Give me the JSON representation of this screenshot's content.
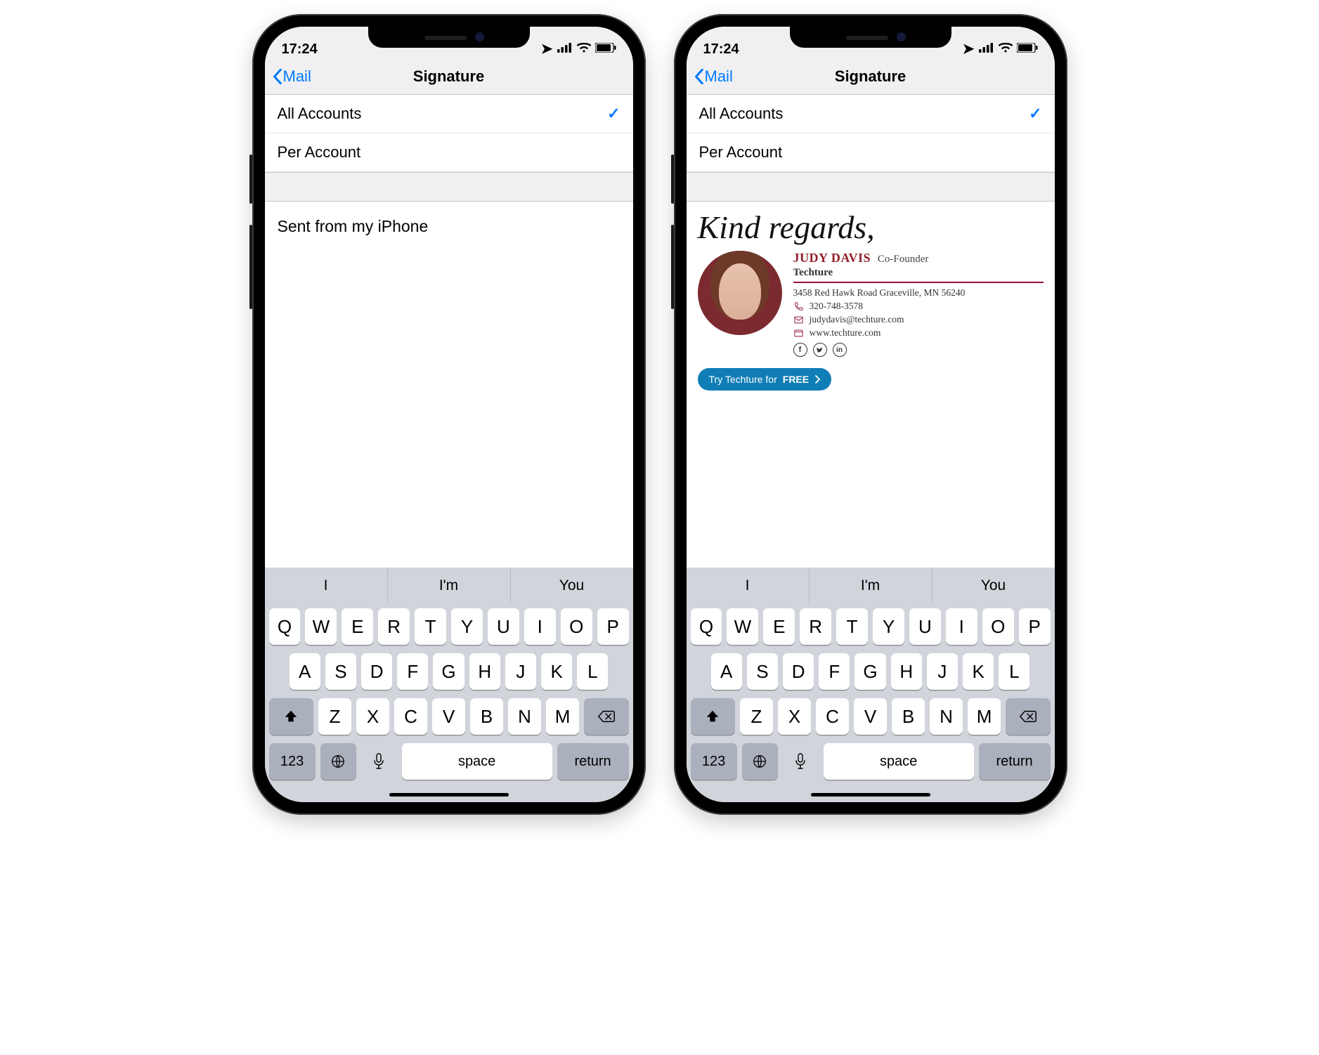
{
  "status": {
    "time": "17:24"
  },
  "nav": {
    "back": "Mail",
    "title": "Signature"
  },
  "options": {
    "all": "All Accounts",
    "per": "Per Account"
  },
  "left": {
    "body": "Sent from my iPhone"
  },
  "right": {
    "greeting": "Kind regards,",
    "name": "JUDY DAVIS",
    "role": "Co-Founder",
    "company": "Techture",
    "address": "3458 Red Hawk Road Graceville, MN 56240",
    "phone": "320-748-3578",
    "email": "judydavis@techture.com",
    "website": "www.techture.com",
    "cta_prefix": "Try Techture for ",
    "cta_bold": "FREE"
  },
  "kb": {
    "pred": [
      "I",
      "I'm",
      "You"
    ],
    "r1": [
      "Q",
      "W",
      "E",
      "R",
      "T",
      "Y",
      "U",
      "I",
      "O",
      "P"
    ],
    "r2": [
      "A",
      "S",
      "D",
      "F",
      "G",
      "H",
      "J",
      "K",
      "L"
    ],
    "r3": [
      "Z",
      "X",
      "C",
      "V",
      "B",
      "N",
      "M"
    ],
    "n123": "123",
    "space": "space",
    "ret": "return"
  }
}
